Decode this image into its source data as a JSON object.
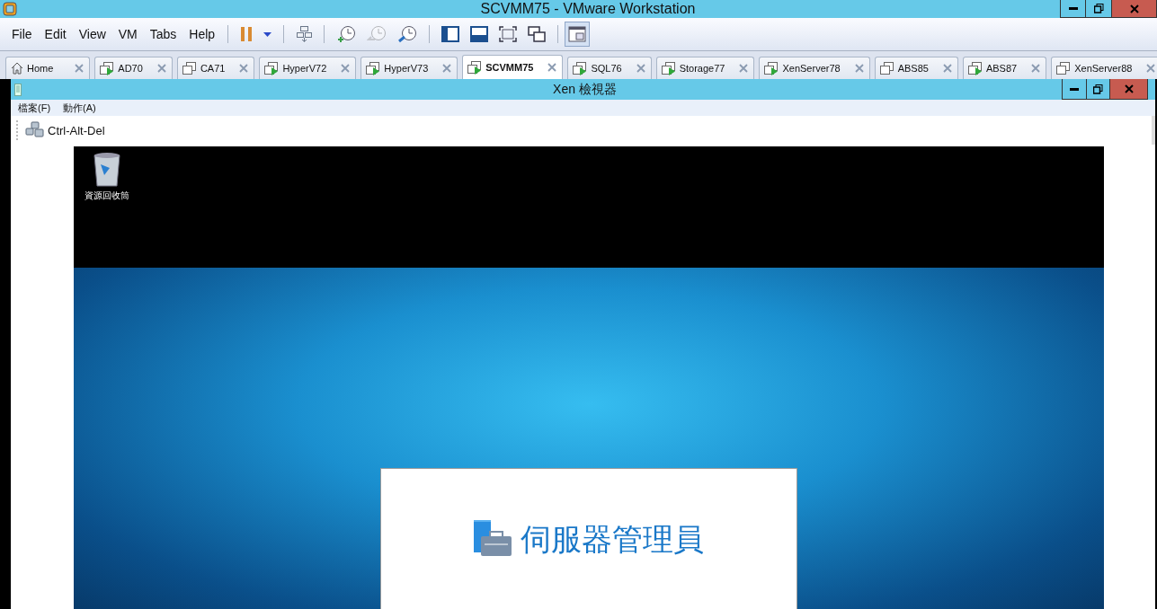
{
  "window": {
    "title": "SCVMM75 - VMware Workstation"
  },
  "menu": [
    "File",
    "Edit",
    "View",
    "VM",
    "Tabs",
    "Help"
  ],
  "toolbar_groups": [
    [
      {
        "kind": "pause",
        "disabled": false,
        "pressed": false
      },
      {
        "kind": "dropdown",
        "disabled": false,
        "pressed": false
      }
    ],
    [
      {
        "kind": "send-keys",
        "disabled": false,
        "pressed": false
      }
    ],
    [
      {
        "kind": "snapshot-take",
        "disabled": false,
        "pressed": false
      },
      {
        "kind": "snapshot-revert",
        "disabled": true,
        "pressed": false
      },
      {
        "kind": "snapshot-manage",
        "disabled": false,
        "pressed": false
      }
    ],
    [
      {
        "kind": "view-sidebar",
        "disabled": false,
        "pressed": false
      },
      {
        "kind": "view-bottom",
        "disabled": false,
        "pressed": false
      },
      {
        "kind": "view-fullscreen",
        "disabled": false,
        "pressed": false
      },
      {
        "kind": "view-windows",
        "disabled": false,
        "pressed": false
      }
    ],
    [
      {
        "kind": "view-console",
        "disabled": false,
        "pressed": true
      }
    ]
  ],
  "tabs": [
    {
      "kind": "home",
      "label": "Home",
      "selected": false
    },
    {
      "kind": "vm",
      "label": "AD70",
      "selected": false,
      "running": true
    },
    {
      "kind": "vm",
      "label": "CA71",
      "selected": false,
      "running": false
    },
    {
      "kind": "vm",
      "label": "HyperV72",
      "selected": false,
      "running": true
    },
    {
      "kind": "vm",
      "label": "HyperV73",
      "selected": false,
      "running": true
    },
    {
      "kind": "vm",
      "label": "SCVMM75",
      "selected": true,
      "running": true
    },
    {
      "kind": "vm",
      "label": "SQL76",
      "selected": false,
      "running": true
    },
    {
      "kind": "vm",
      "label": "Storage77",
      "selected": false,
      "running": true
    },
    {
      "kind": "vm",
      "label": "XenServer78",
      "selected": false,
      "running": true
    },
    {
      "kind": "vm",
      "label": "ABS85",
      "selected": false,
      "running": false
    },
    {
      "kind": "vm",
      "label": "ABS87",
      "selected": false,
      "running": true
    },
    {
      "kind": "vm",
      "label": "XenServer88",
      "selected": false,
      "running": false
    }
  ],
  "viewer": {
    "title": "Xen 檢視器",
    "menu": [
      "檔案(F)",
      "動作(A)"
    ],
    "toolbar_button": "Ctrl-Alt-Del",
    "desktop": {
      "icon_label": "資源回收筒",
      "splash_title": "伺服器管理員"
    }
  }
}
